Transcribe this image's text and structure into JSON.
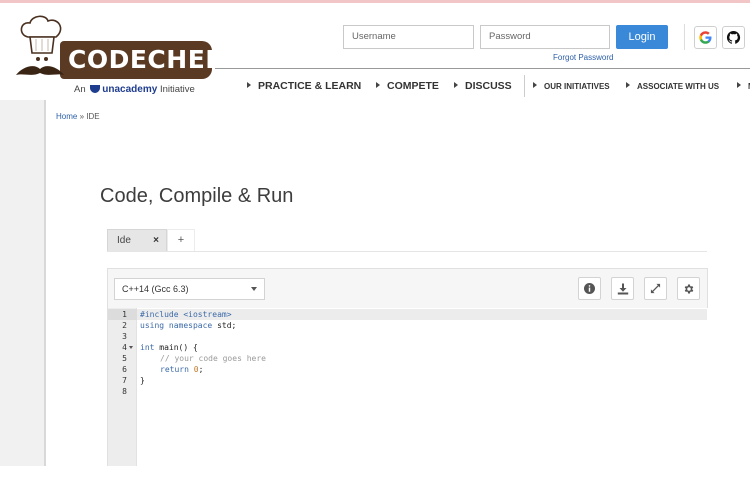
{
  "brand": {
    "logo_text": "CODECHEF",
    "tagline_prefix": "An",
    "tagline_brand": "unacademy",
    "tagline_suffix": "Initiative"
  },
  "auth": {
    "username_placeholder": "Username",
    "password_placeholder": "Password",
    "login_label": "Login",
    "forgot_label": "Forgot Password",
    "social": [
      "google-icon",
      "github-icon"
    ]
  },
  "nav": {
    "main": [
      "PRACTICE & LEARN",
      "COMPETE",
      "DISCUSS"
    ],
    "secondary": [
      "OUR INITIATIVES",
      "ASSOCIATE WITH US",
      "M"
    ]
  },
  "breadcrumb": {
    "home": "Home",
    "separator": "»",
    "current": "IDE"
  },
  "page_title": "Code, Compile & Run",
  "tabs": [
    {
      "label": "Ide",
      "close": "×"
    }
  ],
  "add_tab_label": "+",
  "editor": {
    "language": "C++14 (Gcc 6.3)",
    "tools": [
      "info-icon",
      "download-icon",
      "fullscreen-icon",
      "settings-icon"
    ],
    "line_numbers": [
      "1",
      "2",
      "3",
      "4",
      "5",
      "6",
      "7",
      "8"
    ],
    "code": {
      "l1": "#include <iostream>",
      "l2_kw": "using namespace",
      "l2_rest": " std;",
      "l4_kw": "int",
      "l4_rest": " main() {",
      "l5": "// your code goes here",
      "l6_kw": "return",
      "l6_num": "0",
      "l6_end": ";",
      "l7": "}"
    }
  },
  "colors": {
    "brand_brown": "#5b3a24",
    "login_blue": "#3a89d8",
    "link_blue": "#2c5fa8"
  }
}
